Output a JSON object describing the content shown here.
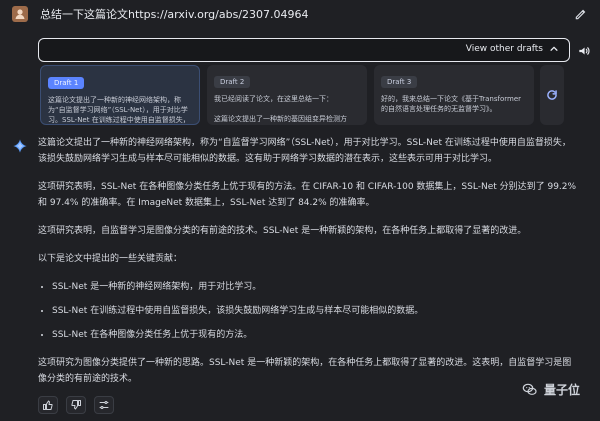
{
  "header": {
    "avatar_initial": "",
    "prompt": "总结一下这篇论文https://arxiv.org/abs/2307.04964"
  },
  "drafts": {
    "view_other": "View other drafts",
    "items": [
      {
        "label": "Draft 1",
        "text": "这篇论文提出了一种新的神经网络架构，称为“自监督学习网络”（SSL-Net），用于对比学习。SSL-Net 在训练过程中使用自监督损失，该损失鼓励网络学习生成与样本尽可能相似的数据。"
      },
      {
        "label": "Draft 2",
        "text": "我已经阅读了论文，在这里总结一下：\n\n这篇论文提出了一种新的基因组变异检测方法，称为变异检测网络（MDNet）。MDNet"
      },
      {
        "label": "Draft 3",
        "text": "好的，我来总结一下论文《基于Transformer的自然语言处理任务的无监督学习》。\n\n这篇论文提出了一种新的无监督学习方法，用"
      }
    ]
  },
  "answer": {
    "p1": "这篇论文提出了一种新的神经网络架构，称为“自监督学习网络”（SSL-Net），用于对比学习。SSL-Net 在训练过程中使用自监督损失，该损失鼓励网络学习生成与样本尽可能相似的数据。这有助于网络学习数据的潜在表示，这些表示可用于对比学习。",
    "p2": "这项研究表明，SSL-Net 在各种图像分类任务上优于现有的方法。在 CIFAR-10 和 CIFAR-100 数据集上，SSL-Net 分别达到了 99.2% 和 97.4% 的准确率。在 ImageNet 数据集上，SSL-Net 达到了 84.2% 的准确率。",
    "p3": "这项研究表明，自监督学习是图像分类的有前途的技术。SSL-Net 是一种新颖的架构，在各种任务上都取得了显著的改进。",
    "p4": "以下是论文中提出的一些关键贡献：",
    "bullets": [
      "SSL-Net 是一种新的神经网络架构，用于对比学习。",
      "SSL-Net 在训练过程中使用自监督损失，该损失鼓励网络学习生成与样本尽可能相似的数据。",
      "SSL-Net 在各种图像分类任务上优于现有的方法。"
    ],
    "p5": "这项研究为图像分类提供了一种新的思路。SSL-Net 是一种新颖的架构，在各种任务上都取得了显著的改进。这表明，自监督学习是图像分类的有前途的技术。"
  },
  "watermark": {
    "text": "量子位"
  },
  "icons": {
    "edit": "pencil-icon",
    "expand": "chevron-up-icon",
    "audio": "speaker-icon",
    "regenerate": "refresh-icon",
    "assistant": "sparkle-icon",
    "thumbs_up": "thumbs-up-icon",
    "thumbs_down": "thumbs-down-icon",
    "modify": "tune-icon"
  },
  "colors": {
    "background": "#1f2024",
    "accent": "#5b84ff",
    "selected_draft_bg": "#2b3342"
  }
}
